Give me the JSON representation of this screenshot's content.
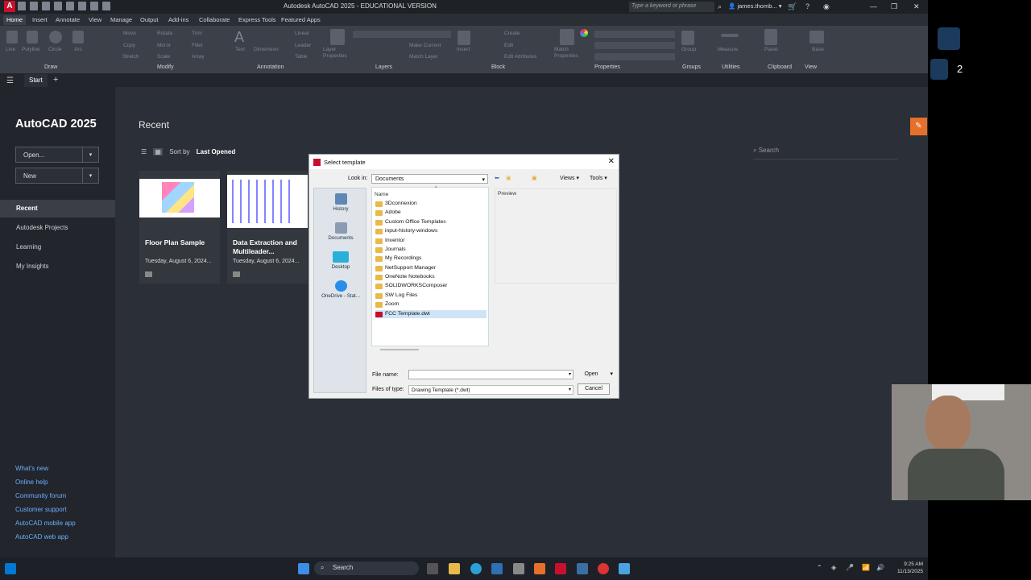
{
  "window": {
    "title": "Autodesk AutoCAD 2025 - EDUCATIONAL VERSION",
    "search_placeholder": "Type a keyword or phrase",
    "user": "james.thomb..."
  },
  "ribbon_tabs": [
    "Home",
    "Insert",
    "Annotate",
    "View",
    "Manage",
    "Output",
    "Add-ins",
    "Collaborate",
    "Express Tools",
    "Featured Apps"
  ],
  "ribbon_tools": {
    "draw": [
      "Line",
      "Polyline",
      "Circle",
      "Arc"
    ],
    "modify": [
      "Move",
      "Rotate",
      "Trim",
      "Copy",
      "Mirror",
      "Fillet",
      "Stretch",
      "Scale",
      "Array"
    ],
    "annotation": [
      "Text",
      "Dimension",
      "Linear",
      "Leader",
      "Table"
    ],
    "layers": [
      "Layer Properties",
      "Make Current",
      "Match Layer"
    ],
    "block": [
      "Insert",
      "Create",
      "Edit",
      "Edit Attributes"
    ],
    "properties": [
      "Match Properties"
    ],
    "other": [
      "Group",
      "Measure",
      "Paste",
      "Base"
    ]
  },
  "panels": [
    "Draw",
    "Modify",
    "Annotation",
    "Layers",
    "Block",
    "Properties",
    "Groups",
    "Utilities",
    "Clipboard",
    "View"
  ],
  "file_tab": "Start",
  "left": {
    "product": "AutoCAD 2025",
    "open": "Open...",
    "new": "New",
    "nav": [
      "Recent",
      "Autodesk Projects",
      "Learning",
      "My Insights"
    ],
    "links": [
      "What's new",
      "Online help",
      "Community forum",
      "Customer support",
      "AutoCAD mobile app",
      "AutoCAD web app"
    ]
  },
  "main": {
    "heading": "Recent",
    "sort_label": "Sort by",
    "sort_value": "Last Opened",
    "search": "Search",
    "cards": [
      {
        "title": "Floor Plan Sample",
        "date": "Tuesday, August 6, 2024..."
      },
      {
        "title": "Data Extraction and Multileader...",
        "date": "Tuesday, August 6, 2024..."
      }
    ]
  },
  "dialog": {
    "title": "Select template",
    "look_in_label": "Look in:",
    "look_in_value": "Documents",
    "views": "Views",
    "tools": "Tools",
    "preview": "Preview",
    "places": [
      "History",
      "Documents",
      "Desktop",
      "OneDrive - Stat..."
    ],
    "column": "Name",
    "files": [
      "3Dconnexion",
      "Adobe",
      "Custom Office Templates",
      "input-history-windows",
      "Inventor",
      "Journals",
      "My Recordings",
      "NetSupport Manager",
      "OneNote Notebooks",
      "SOLIDWORKSComposer",
      "SW Log Files",
      "Zoom",
      "FCC Template.dwt"
    ],
    "file_name_label": "File name:",
    "file_name_value": "",
    "files_of_type_label": "Files of type:",
    "files_of_type_value": "Drawing Template (*.dwt)",
    "open": "Open",
    "cancel": "Cancel"
  },
  "taskbar": {
    "search": "Search",
    "time": "9:25 AM",
    "date": "11/13/2025"
  },
  "overlay": {
    "mouse_count": "2"
  }
}
